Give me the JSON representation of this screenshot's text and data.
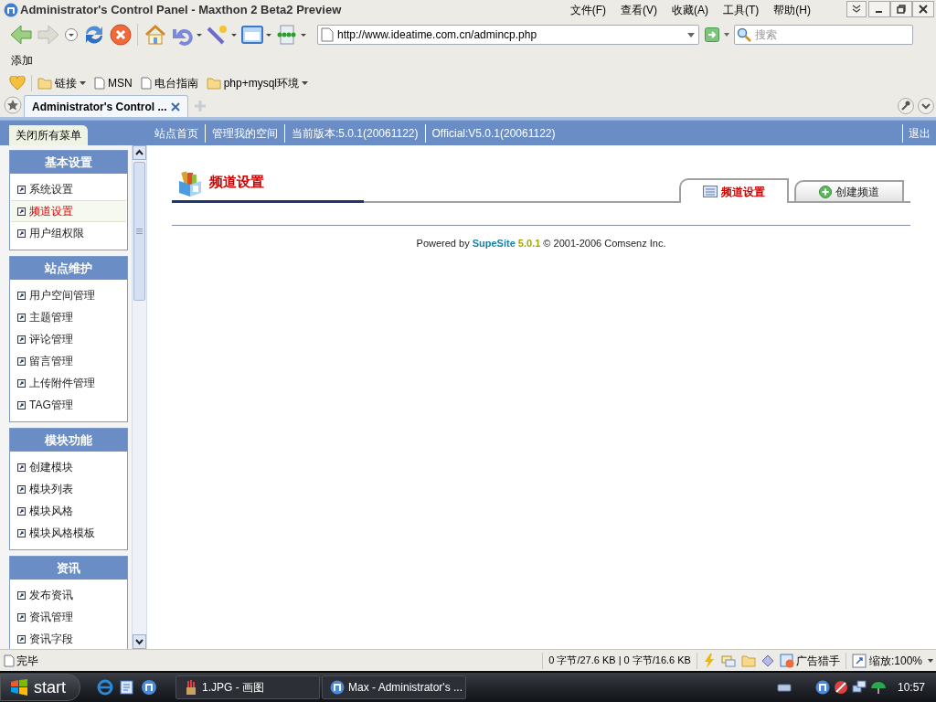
{
  "window": {
    "title": "Administrator's Control Panel - Maxthon 2 Beta2 Preview"
  },
  "menu": [
    "文件(F)",
    "查看(V)",
    "收藏(A)",
    "工具(T)",
    "帮助(H)"
  ],
  "address": {
    "value": "http://www.ideatime.com.cn/admincp.php"
  },
  "search": {
    "placeholder": "搜索"
  },
  "command_bar": "添加",
  "bookmarks": [
    {
      "label": "链接",
      "kind": "folder"
    },
    {
      "label": "MSN",
      "kind": "page"
    },
    {
      "label": "电台指南",
      "kind": "page"
    },
    {
      "label": "php+mysql环境",
      "kind": "folder"
    }
  ],
  "tabs": [
    {
      "label": "Administrator's Control ...",
      "selected": true
    }
  ],
  "nav": {
    "close_all": "关闭所有菜单",
    "links": [
      "站点首页",
      "管理我的空间",
      "当前版本:5.0.1(20061122)",
      "Official:V5.0.1(20061122)"
    ],
    "logout": "退出"
  },
  "sidebar": {
    "groups": [
      {
        "title": "基本设置",
        "items": [
          {
            "label": "系统设置",
            "selected": false
          },
          {
            "label": "频道设置",
            "selected": true
          },
          {
            "label": "用户组权限",
            "selected": false
          }
        ]
      },
      {
        "title": "站点维护",
        "items": [
          {
            "label": "用户空间管理",
            "selected": false
          },
          {
            "label": "主题管理",
            "selected": false
          },
          {
            "label": "评论管理",
            "selected": false
          },
          {
            "label": "留言管理",
            "selected": false
          },
          {
            "label": "上传附件管理",
            "selected": false
          },
          {
            "label": "TAG管理",
            "selected": false
          }
        ]
      },
      {
        "title": "模块功能",
        "items": [
          {
            "label": "创建模块",
            "selected": false
          },
          {
            "label": "模块列表",
            "selected": false
          },
          {
            "label": "模块风格",
            "selected": false
          },
          {
            "label": "模块风格模板",
            "selected": false
          }
        ]
      },
      {
        "title": "资讯",
        "items": [
          {
            "label": "发布资讯",
            "selected": false
          },
          {
            "label": "资讯管理",
            "selected": false
          },
          {
            "label": "资讯字段",
            "selected": false
          }
        ]
      }
    ]
  },
  "page": {
    "heading": "频道设置",
    "tabs": [
      {
        "label": "频道设置",
        "selected": true,
        "kind": "list"
      },
      {
        "label": "创建频道",
        "selected": false,
        "kind": "add"
      }
    ],
    "footer": "Powered by **SupeSite** **5.0.1** © 2001-2006 Comsenz Inc."
  },
  "status_bar": {
    "status": "完毕",
    "traffic": "0 字节/27.6 KB | 0 字节/16.6 KB",
    "ad_hunter": "广告猎手",
    "zoom": "缩放:100%"
  },
  "taskbar": {
    "start": "start",
    "tasks": [
      "1.JPG - 画图",
      "Max - Administrator's ..."
    ],
    "clock": "10:57"
  }
}
